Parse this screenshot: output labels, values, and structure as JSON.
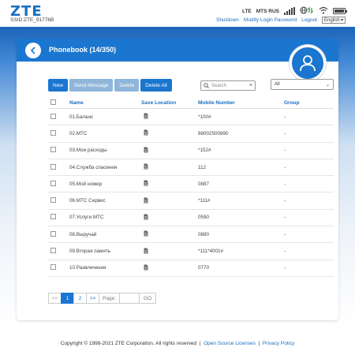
{
  "header": {
    "logo": "ZTE",
    "ssid": "SSID:ZTE_91776B",
    "network_type": "LTE",
    "operator": "MTS RUS",
    "links": {
      "shutdown": "Shutdown",
      "modify_password": "Modify Login Password",
      "logout": "Logout"
    },
    "language": "English",
    "language_arrow": "▾"
  },
  "card": {
    "title": "Phonebook (14/350)",
    "back_glyph": "‹"
  },
  "toolbar": {
    "new": "New",
    "send_message": "Send Message",
    "delete": "Delete",
    "delete_all": "Delete All"
  },
  "search": {
    "placeholder": "Search",
    "clear": "×"
  },
  "group_filter": {
    "selected": "All",
    "arrow": "⌄"
  },
  "table": {
    "columns": {
      "name": "Name",
      "save_location": "Save Location",
      "mobile": "Mobile Number",
      "group": "Group"
    },
    "rows": [
      {
        "name": "01.Баланс",
        "mobile": "*100#",
        "group": "-"
      },
      {
        "name": "02.МТС",
        "mobile": "88002500890",
        "group": "-"
      },
      {
        "name": "03.Мои расходы",
        "mobile": "*152#",
        "group": "-"
      },
      {
        "name": "04.Служба спасения",
        "mobile": "112",
        "group": "-"
      },
      {
        "name": "05.Мой номер",
        "mobile": "0887",
        "group": "-"
      },
      {
        "name": "06.МТС Сервис",
        "mobile": "*111#",
        "group": "-"
      },
      {
        "name": "07.Услуги МТС",
        "mobile": "0590",
        "group": "-"
      },
      {
        "name": "08.Выручай",
        "mobile": "0880",
        "group": "-"
      },
      {
        "name": "09.Вторая память",
        "mobile": "*111*4001#",
        "group": "-"
      },
      {
        "name": "10.Развлечения",
        "mobile": "0770",
        "group": "-"
      }
    ]
  },
  "pagination": {
    "prev": "<<",
    "pages": [
      "1",
      "2"
    ],
    "current": "1",
    "next": ">>",
    "page_label": "Page:",
    "page_value": "",
    "go": "GO"
  },
  "footer": {
    "copyright": "Copyright © 1998-2021 ZTE Corporation. All rights reserved",
    "sep": "|",
    "open_source": "Open Source Licenses",
    "privacy": "Privacy Policy"
  },
  "colors": {
    "accent": "#1a76cf",
    "link": "#1a6fc1"
  },
  "status": {
    "signal_bars": 4,
    "battery_level": 1.0
  }
}
